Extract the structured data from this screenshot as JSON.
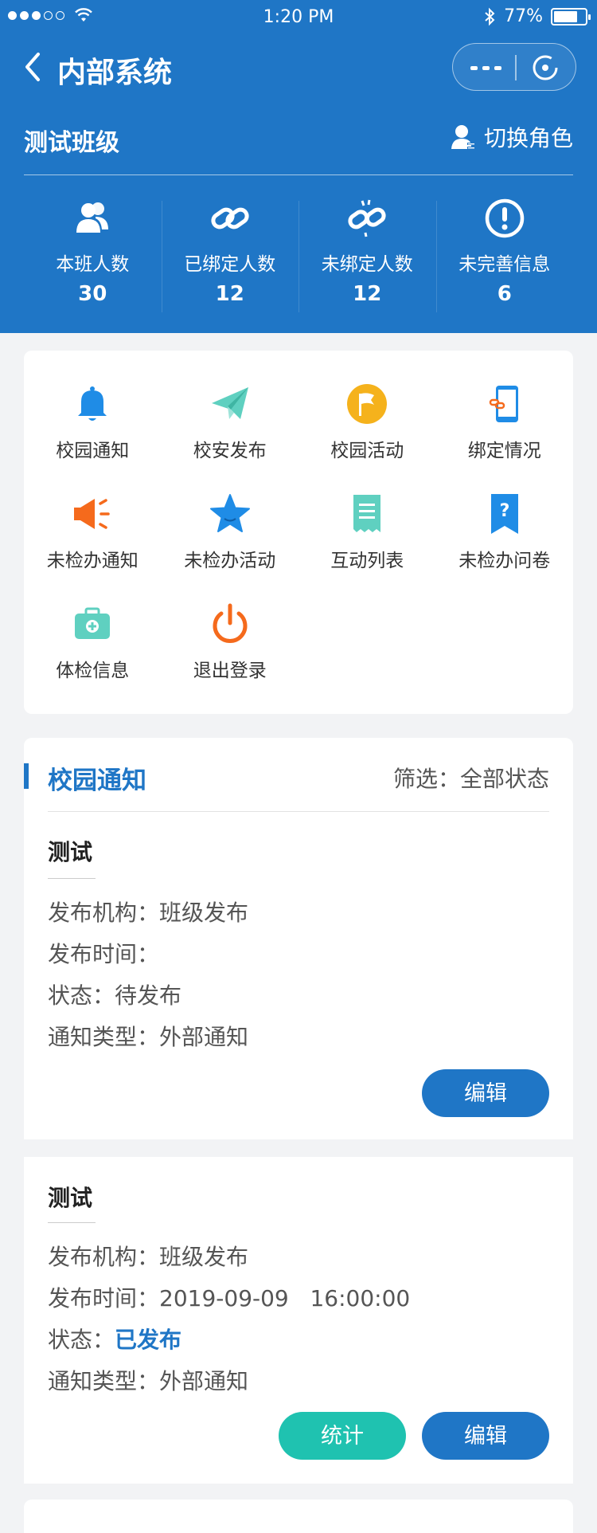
{
  "status_bar": {
    "time": "1:20 PM",
    "battery_text": "77%",
    "battery_level": 0.77
  },
  "nav": {
    "title": "内部系统",
    "back_icon": "chevron-left-icon",
    "more_icon": "more-dots-icon",
    "close_icon": "target-close-icon"
  },
  "class_info": {
    "name": "测试班级",
    "switch_role_label": "切换角色"
  },
  "stats": [
    {
      "label": "本班人数",
      "value": "30",
      "icon": "people-icon"
    },
    {
      "label": "已绑定人数",
      "value": "12",
      "icon": "link-icon"
    },
    {
      "label": "未绑定人数",
      "value": "12",
      "icon": "broken-link-icon"
    },
    {
      "label": "未完善信息",
      "value": "6",
      "icon": "exclamation-icon"
    }
  ],
  "menu": [
    {
      "label": "校园通知",
      "icon": "bell-icon",
      "color": "#1f8ce6"
    },
    {
      "label": "校安发布",
      "icon": "paper-plane-icon",
      "color": "#5fd0c0"
    },
    {
      "label": "校园活动",
      "icon": "flag-icon",
      "color": "#f5b21c"
    },
    {
      "label": "绑定情况",
      "icon": "phone-link-icon",
      "color": "#1f8ce6"
    },
    {
      "label": "未检办通知",
      "icon": "megaphone-icon",
      "color": "#f56a1c"
    },
    {
      "label": "未检办活动",
      "icon": "star-icon",
      "color": "#1f8ce6"
    },
    {
      "label": "互动列表",
      "icon": "receipt-icon",
      "color": "#5fd0c0"
    },
    {
      "label": "未检办问卷",
      "icon": "question-bookmark-icon",
      "color": "#1f8ce6"
    },
    {
      "label": "体检信息",
      "icon": "medical-kit-icon",
      "color": "#5fd0c0"
    },
    {
      "label": "退出登录",
      "icon": "power-icon",
      "color": "#f56a1c"
    }
  ],
  "notice_section": {
    "title": "校园通知",
    "filter_label": "筛选：",
    "filter_value": "全部状态"
  },
  "notices": [
    {
      "title": "测试",
      "org_label": "发布机构：",
      "org_value": "班级发布",
      "time_label": "发布时间：",
      "time_value": "",
      "status_label": "状态：",
      "status_value": "待发布",
      "type_label": "通知类型：",
      "type_value": "外部通知",
      "edit_label": "编辑"
    },
    {
      "title": "测试",
      "org_label": "发布机构：",
      "org_value": "班级发布",
      "time_label": "发布时间：",
      "time_value": "2019-09-09   16:00:00",
      "status_label": "状态：",
      "status_value": "已发布",
      "type_label": "通知类型：",
      "type_value": "外部通知",
      "stats_label": "统计",
      "edit_label": "编辑"
    }
  ],
  "colors": {
    "primary": "#1f76c6",
    "teal": "#1fc2b0",
    "background": "#f2f3f5"
  }
}
